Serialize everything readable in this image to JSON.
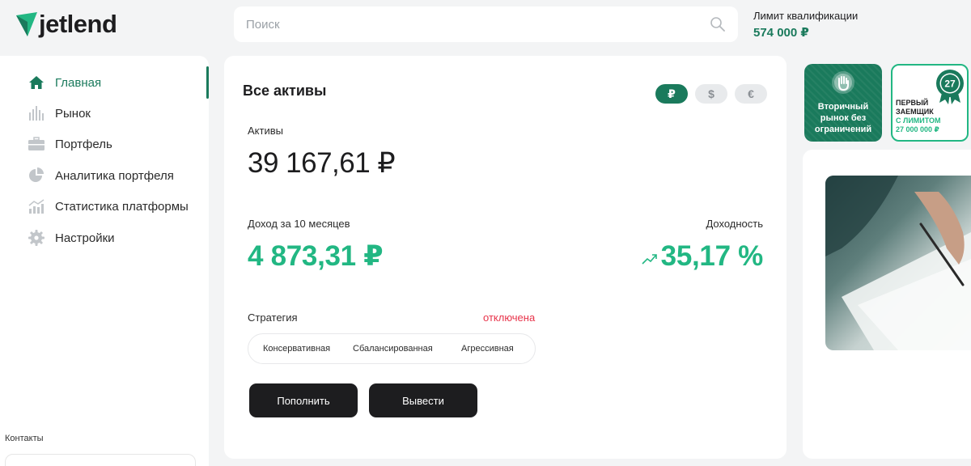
{
  "header": {
    "logo_text": "jetlend",
    "search_placeholder": "Поиск",
    "limit_label": "Лимит квалификации",
    "limit_value": "574 000 ₽"
  },
  "sidebar": {
    "items": [
      {
        "label": "Главная",
        "icon": "home-icon",
        "active": true
      },
      {
        "label": "Рынок",
        "icon": "market-bars-icon"
      },
      {
        "label": "Портфель",
        "icon": "briefcase-icon"
      },
      {
        "label": "Аналитика портфеля",
        "icon": "pie-chart-icon"
      },
      {
        "label": "Статистика платформы",
        "icon": "stats-icon"
      },
      {
        "label": "Настройки",
        "icon": "gear-icon"
      }
    ],
    "contacts_label": "Контакты"
  },
  "main": {
    "title": "Все активы",
    "currencies": [
      "₽",
      "$",
      "€"
    ],
    "assets_label": "Активы",
    "assets_value": "39 167,61 ₽",
    "income_label": "Доход за 10 месяцев",
    "income_value": "4 873,31 ₽",
    "yield_label": "Доходность",
    "yield_value": "35,17 %",
    "strategy_label": "Стратегия",
    "strategy_status": "отключена",
    "strategies": [
      "Консервативная",
      "Сбалансированная",
      "Агрессивная"
    ],
    "deposit_label": "Пополнить",
    "withdraw_label": "Вывести"
  },
  "right": {
    "promo1_line1": "Вторичный",
    "promo1_line2": "рынок без",
    "promo1_line3": "ограничений",
    "promo2_badge": "27",
    "promo2_line1": "ПЕРВЫЙ",
    "promo2_line2": "ЗАЕМЩИК",
    "promo2_line3": "С ЛИМИТОМ",
    "promo2_line4": "27 000 000 ₽"
  },
  "colors": {
    "brand": "#1a7a5c",
    "accent_green": "#22b783",
    "danger": "#e8334a",
    "button_dark": "#1d1d1f"
  }
}
